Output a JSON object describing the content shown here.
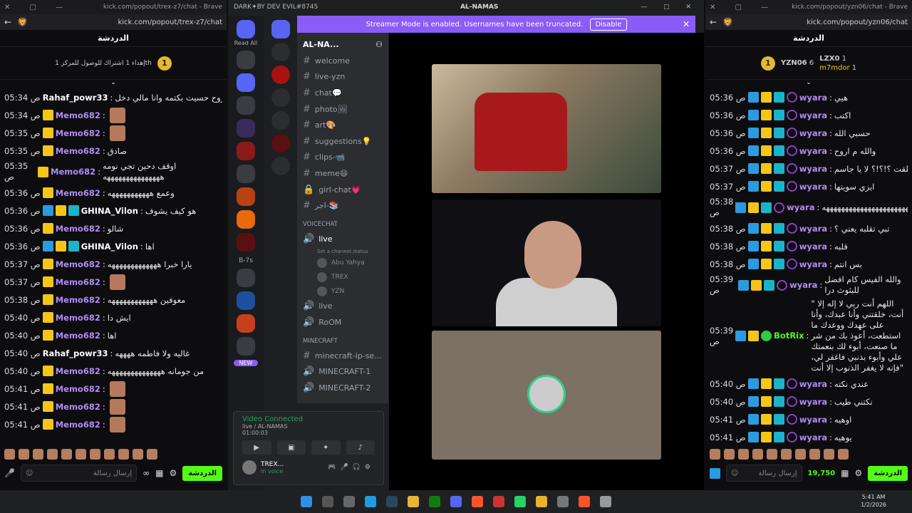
{
  "left": {
    "tab": "kick.com/popout/trex-z7/chat - Brave",
    "url": "kick.com/popout/trex-z7/chat",
    "header": "الدردشة",
    "pinned": "إهداء 1 اشتراك للوصول للمركز 1th",
    "input_placeholder": "إرسال رسالة",
    "chat_btn": "الدردشة",
    "messages": [
      {
        "time": "05:34 ص",
        "user": "Rahaf_powr33",
        "text": "قبل لاروح حسيت بكتمه وانا مالي دخل",
        "badges": [],
        "ucls": "w"
      },
      {
        "time": "05:34 ص",
        "user": "Memo682",
        "text": "",
        "badges": [
          "crown"
        ],
        "ucls": "g",
        "emoji": true
      },
      {
        "time": "05:35 ص",
        "user": "Memo682",
        "text": "",
        "badges": [
          "crown"
        ],
        "ucls": "g",
        "emoji": true
      },
      {
        "time": "05:35 ص",
        "user": "Memo682",
        "text": "صادق",
        "badges": [
          "crown"
        ],
        "ucls": "g"
      },
      {
        "time": "05:35 ص",
        "user": "Memo682",
        "text": "اوقف دحين تجي نومه هههههههههههههههه",
        "badges": [
          "crown"
        ],
        "ucls": "g",
        "wrap": true
      },
      {
        "time": "05:36 ص",
        "user": "Memo682",
        "text": "وعمع هههههههههههه",
        "badges": [
          "crown"
        ],
        "ucls": "g"
      },
      {
        "time": "05:36 ص",
        "user": "GHINA_Vilon",
        "text": "هو كيف يشوف",
        "badges": [
          "pick",
          "crown",
          "sub"
        ],
        "ucls": "w"
      },
      {
        "time": "05:36 ص",
        "user": "Memo682",
        "text": "شالو",
        "badges": [
          "crown"
        ],
        "ucls": "g"
      },
      {
        "time": "05:36 ص",
        "user": "GHINA_Vilon",
        "text": "اها",
        "badges": [
          "pick",
          "crown",
          "sub"
        ],
        "ucls": "w"
      },
      {
        "time": "05:37 ص",
        "user": "Memo682",
        "text": "يارا خبرا هههههههههههههه",
        "badges": [
          "crown"
        ],
        "ucls": "g"
      },
      {
        "time": "05:37 ص",
        "user": "Memo682",
        "text": "",
        "badges": [
          "crown"
        ],
        "ucls": "g",
        "emoji": true
      },
      {
        "time": "05:38 ص",
        "user": "Memo682",
        "text": "معوفين ههههههههههههه",
        "badges": [
          "crown"
        ],
        "ucls": "g"
      },
      {
        "time": "05:40 ص",
        "user": "Memo682",
        "text": "ايش دا",
        "badges": [
          "crown"
        ],
        "ucls": "g"
      },
      {
        "time": "05:40 ص",
        "user": "Memo682",
        "text": "اها",
        "badges": [
          "crown"
        ],
        "ucls": "g"
      },
      {
        "time": "05:40 ص",
        "user": "Rahaf_powr33",
        "text": "غاليه ولا فاطمه ههههه",
        "badges": [],
        "ucls": "w"
      },
      {
        "time": "05:40 ص",
        "user": "Memo682",
        "text": "من جومانه ههههههههههههههه",
        "badges": [
          "crown"
        ],
        "ucls": "g"
      },
      {
        "time": "05:41 ص",
        "user": "Memo682",
        "text": "",
        "badges": [
          "crown"
        ],
        "ucls": "g",
        "emoji": true
      },
      {
        "time": "05:41 ص",
        "user": "Memo682",
        "text": "",
        "badges": [
          "crown"
        ],
        "ucls": "g",
        "emoji": true
      },
      {
        "time": "05:41 ص",
        "user": "Memo682",
        "text": "",
        "badges": [
          "crown"
        ],
        "ucls": "g",
        "emoji": true
      }
    ]
  },
  "right": {
    "tab": "kick.com/popout/yzn06/chat - Brave",
    "url": "kick.com/popout/yzn06/chat",
    "header": "الدردشة",
    "top1": "YZN06",
    "top1n": "6",
    "top2": "LZX0",
    "top2n": "1",
    "top3": "m7mdor",
    "top3n": "1",
    "input_placeholder": "إرسال رسالة",
    "points": "19,750",
    "chat_btn": "الدردشة",
    "messages": [
      {
        "time": "05:36 ص",
        "user": "wyara",
        "text": "هيي"
      },
      {
        "time": "05:36 ص",
        "user": "wyara",
        "text": "اكتب"
      },
      {
        "time": "05:36 ص",
        "user": "wyara",
        "text": "حسبي الله"
      },
      {
        "time": "05:36 ص",
        "user": "wyara",
        "text": "والله م اروح"
      },
      {
        "time": "05:37 ص",
        "user": "wyara",
        "text": "طلقت ؟!؟!؟ لا يا جاسم"
      },
      {
        "time": "05:37 ص",
        "user": "wyara",
        "text": "ايزي سويتها"
      },
      {
        "time": "05:38 ص",
        "user": "wyara",
        "text": "ههههههههههههههههههههههههههههه",
        "wrap": true
      },
      {
        "time": "05:38 ص",
        "user": "wyara",
        "text": "تبي تقلبه يعني ؟"
      },
      {
        "time": "05:38 ص",
        "user": "wyara",
        "text": "قلبه"
      },
      {
        "time": "05:38 ص",
        "user": "wyara",
        "text": "بس انتم"
      },
      {
        "time": "05:39 ص",
        "user": "wyara",
        "text": "والله الفيس كام افضل للبثوث درا",
        "wrap": true
      },
      {
        "time": "05:39 ص",
        "user": "BotRix",
        "text": "\" اللهم أنت ربي لا إله إلا أنت، خلقتني وأنا عبدك، وأنا على عهدك ووعدك ما استطعت، أعوذ بك من شر ما صنعت، أبوء لك بنعمتك علي وأبوء بذنبي فاغفر لي، فإنه لا يغفر الذنوب إلا أنت\"",
        "bot": true,
        "wrap": true
      },
      {
        "time": "05:40 ص",
        "user": "wyara",
        "text": "عندي نكته"
      },
      {
        "time": "05:40 ص",
        "user": "wyara",
        "text": "نكتني طيب"
      },
      {
        "time": "05:41 ص",
        "user": "wyara",
        "text": "اوهيه"
      },
      {
        "time": "05:41 ص",
        "user": "wyara",
        "text": "يوهيه"
      }
    ]
  },
  "discord": {
    "title_left": "DARK✦BY DEV EVIL#8745",
    "title_center": "AL-NAMAS",
    "banner": "Streamer Mode is enabled. Usernames have been truncated.",
    "banner_btn": "Disable",
    "read_all": "Read All",
    "server": "AL-NA...",
    "b7s": "B-7s",
    "new": "NEW",
    "channels": [
      "welcome",
      "live-yzn",
      "chat💬",
      "photo🖼",
      "art🎨",
      "suggestions💡",
      "clips-📹",
      "meme😄",
      "girl-chat💗",
      "اجر-📚"
    ],
    "cat_voice": "VOICECHAT",
    "live": "live",
    "set_status": "Set a channel status",
    "voice_users": [
      "Abu Yahya",
      "TREX",
      "YZN"
    ],
    "voice_ch": [
      "live",
      "RoOM"
    ],
    "cat_mc": "MINECRAFT",
    "mc": [
      "minecraft-ip-se...",
      "MINECRAFT-1",
      "MINECRAFT-2"
    ],
    "vc_status": "Video Connected",
    "vc_sub": "live / AL-NAMAS",
    "vc_time": "01:00:03",
    "user": "TREX...",
    "user_status": "In voice"
  },
  "taskbar": {
    "time": "5:41 AM",
    "date": "1/2/2026"
  }
}
